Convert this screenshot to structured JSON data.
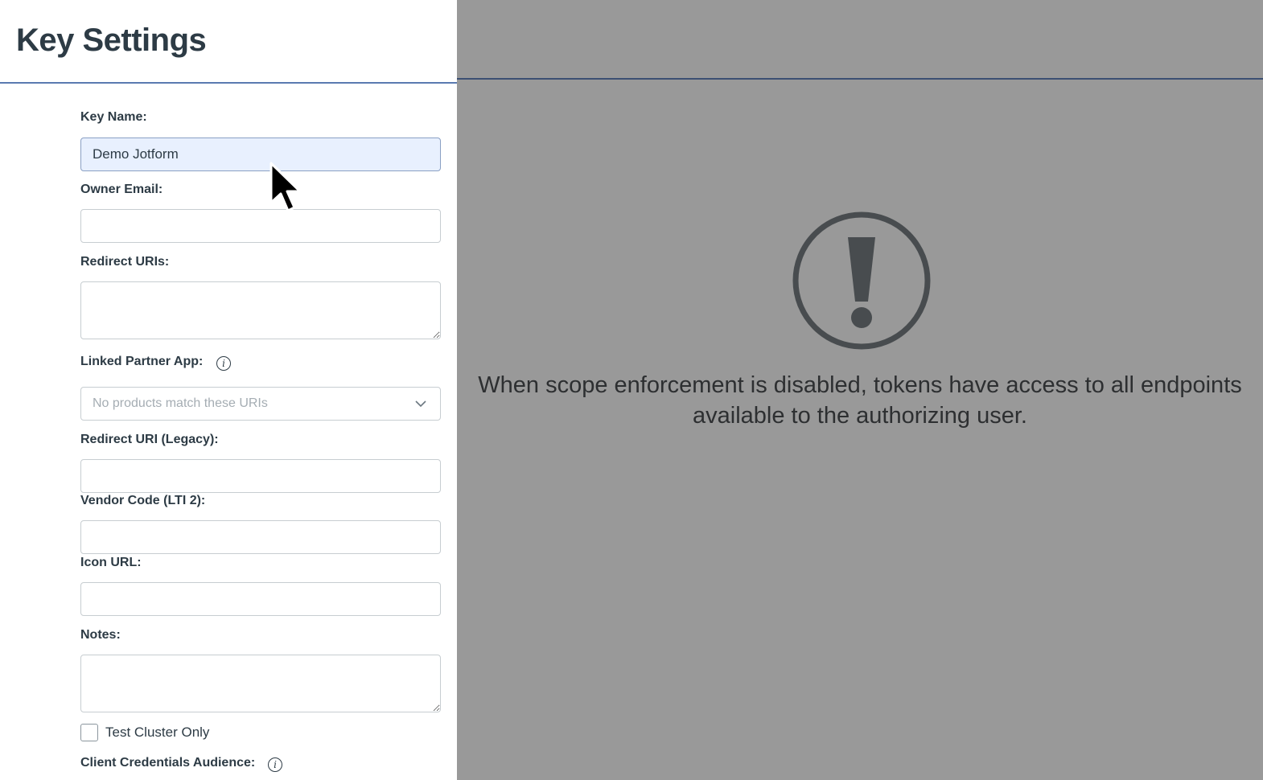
{
  "header": {
    "title": "Key Settings"
  },
  "form": {
    "key_name": {
      "label": "Key Name:",
      "value": "Demo Jotform"
    },
    "owner_email": {
      "label": "Owner Email:",
      "value": ""
    },
    "redirect_uris": {
      "label": "Redirect URIs:",
      "value": ""
    },
    "linked_partner_app": {
      "label": "Linked Partner App:",
      "placeholder": "No products match these URIs"
    },
    "redirect_uri_legacy": {
      "label": "Redirect URI (Legacy):",
      "value": ""
    },
    "vendor_code": {
      "label": "Vendor Code (LTI 2):",
      "value": ""
    },
    "icon_url": {
      "label": "Icon URL:",
      "value": ""
    },
    "notes": {
      "label": "Notes:",
      "value": ""
    },
    "test_cluster_only": {
      "label": "Test Cluster Only",
      "checked": false
    },
    "client_credentials_audience": {
      "label": "Client Credentials Audience:"
    }
  },
  "overlay": {
    "message": "When scope enforcement is disabled, tokens have access to all endpoints available to the authorizing user.",
    "icon": "exclamation-circle-icon",
    "background_color": "#999999"
  },
  "icons": {
    "info": "info-icon",
    "dropdown": "chevron-down-icon",
    "cursor": "mouse-pointer-icon"
  },
  "colors": {
    "accent_line": "#5a7ab0",
    "text": "#2d3b45",
    "focused_input_bg": "#e8f0fe"
  }
}
